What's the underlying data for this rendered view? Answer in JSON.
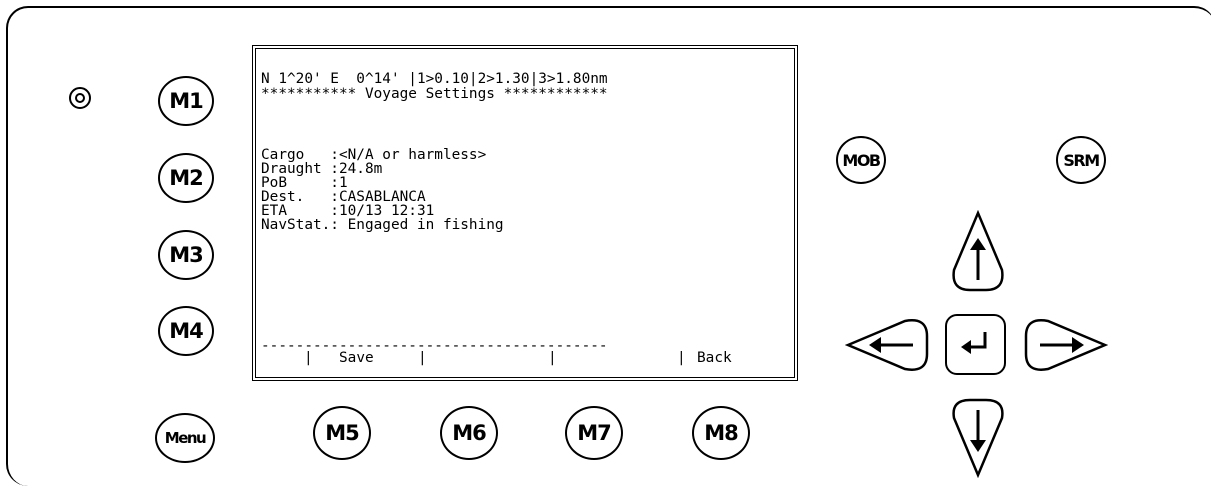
{
  "device": {
    "screen": {
      "status_line": "N 1^20' E  0^14' |1>0.10|2>1.30|3>1.80nm",
      "title_line": "*********** Voyage Settings ************",
      "fields": [
        "Cargo   :<N/A or harmless>",
        "Draught :24.8m",
        "PoB     :1",
        "Dest.   :CASABLANCA",
        "ETA     :10/13 12:31",
        "NavStat.: Engaged in fishing"
      ],
      "separator": "----------------------------------------",
      "softkeys": {
        "k1": "Save",
        "k2": "",
        "k3": "",
        "k4": "Back"
      }
    },
    "left_buttons": [
      "M1",
      "M2",
      "M3",
      "M4",
      "Menu"
    ],
    "bottom_buttons": [
      "M5",
      "M6",
      "M7",
      "M8"
    ],
    "right_buttons": {
      "mob": "MOB",
      "srm": "SRM"
    },
    "icons": {
      "led": "led-indicator-icon",
      "up": "arrow-up-icon",
      "down": "arrow-down-icon",
      "left": "arrow-left-icon",
      "right": "arrow-right-icon",
      "enter": "enter-icon"
    }
  }
}
